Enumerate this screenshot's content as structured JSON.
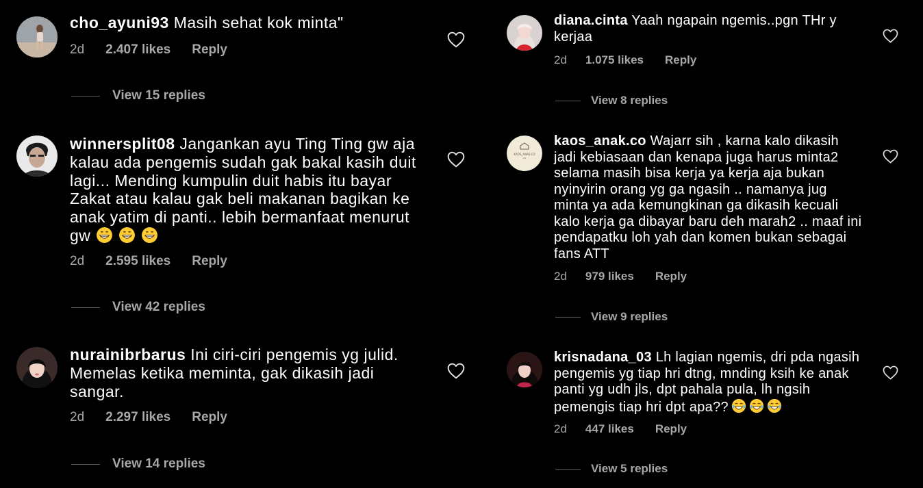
{
  "left_column": {
    "comments": [
      {
        "username": "cho_ayuni93",
        "text": "Masih sehat kok minta\"",
        "time": "2d",
        "likes": "2.407 likes",
        "reply_label": "Reply",
        "view_replies": "View 15 replies"
      },
      {
        "username": "winnersplit08",
        "text": "Jangankan ayu Ting Ting gw aja kalau ada pengemis sudah gak bakal kasih duit lagi... Mending kumpulin duit habis itu bayar Zakat atau kalau gak beli makanan bagikan ke anak yatim di panti.. lebih bermanfaat menurut gw",
        "emoji": "😁😁😁",
        "time": "2d",
        "likes": "2.595 likes",
        "reply_label": "Reply",
        "view_replies": "View 42 replies"
      },
      {
        "username": "nurainibrbarus",
        "text": "Ini ciri-ciri pengemis yg julid. Memelas ketika meminta, gak dikasih jadi sangar.",
        "time": "2d",
        "likes": "2.297 likes",
        "reply_label": "Reply",
        "view_replies": "View 14 replies"
      }
    ]
  },
  "right_column": {
    "comments": [
      {
        "username": "diana.cinta",
        "text": "Yaah ngapain ngemis..pgn THr y kerjaa",
        "time": "2d",
        "likes": "1.075 likes",
        "reply_label": "Reply",
        "view_replies": "View 8 replies"
      },
      {
        "username": "kaos_anak.co",
        "text": "Wajarr sih , karna kalo dikasih jadi kebiasaan dan kenapa juga harus minta2 selama masih bisa kerja ya kerja aja bukan nyinyirin orang yg ga ngasih .. namanya jug minta ya ada kemungkinan ga dikasih kecuali kalo kerja ga dibayar baru deh marah2 .. maaf ini pendapatku loh yah dan komen bukan sebagai fans ATT",
        "avatar_text": "KAOS_ANAK.CO",
        "time": "2d",
        "likes": "979 likes",
        "reply_label": "Reply",
        "view_replies": "View 9 replies"
      },
      {
        "username": "krisnadana_03",
        "text": "Lh lagian ngemis, dri pda ngasih pengemis yg tiap hri dtng, mnding ksih ke anak panti yg udh jls, dpt pahala pula, lh ngsih pemengis tiap hri dpt apa??",
        "emoji": "😂😂😂",
        "time": "2d",
        "likes": "447 likes",
        "reply_label": "Reply",
        "view_replies": "View 5 replies"
      }
    ]
  },
  "colors": {
    "background": "#000000",
    "primary_text": "#ffffff",
    "secondary_text": "#a8a8a8",
    "divider": "#5c5c5c"
  },
  "icons": {
    "like": "heart-outline-icon",
    "emoji_grin": "grinning-face-emoji",
    "emoji_laugh": "tears-of-joy-emoji"
  }
}
